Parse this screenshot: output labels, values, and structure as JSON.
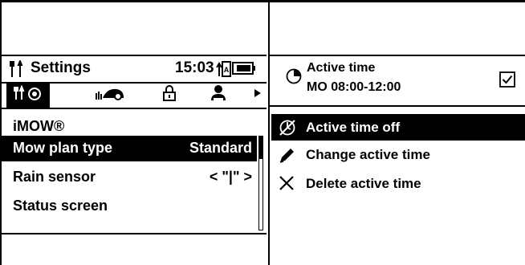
{
  "left": {
    "title": "Settings",
    "time": "15:03",
    "tabs": [
      {
        "icon": "settings-tools-icon",
        "active": true
      },
      {
        "icon": "mower-icon",
        "active": false
      },
      {
        "icon": "lock-icon",
        "active": false
      },
      {
        "icon": "user-icon",
        "active": false
      },
      {
        "icon": "arrow-right-icon",
        "active": false
      }
    ],
    "menu_heading": "iMOW®",
    "rows": [
      {
        "label": "Mow plan type",
        "value": "Standard",
        "selected": true
      },
      {
        "label": "Rain sensor",
        "value": "< \"|\" >",
        "selected": false
      },
      {
        "label": "Status screen",
        "value": "",
        "selected": false
      }
    ]
  },
  "right": {
    "header_label": "Active time",
    "header_value": "MO 08:00-12:00",
    "checked": true,
    "menu": [
      {
        "icon": "no-time-icon",
        "label": "Active time off",
        "selected": true
      },
      {
        "icon": "pencil-icon",
        "label": "Change active time",
        "selected": false
      },
      {
        "icon": "x-icon",
        "label": "Delete active time",
        "selected": false
      }
    ]
  },
  "colors": {
    "foreground": "#000000",
    "background": "#ffffff"
  }
}
